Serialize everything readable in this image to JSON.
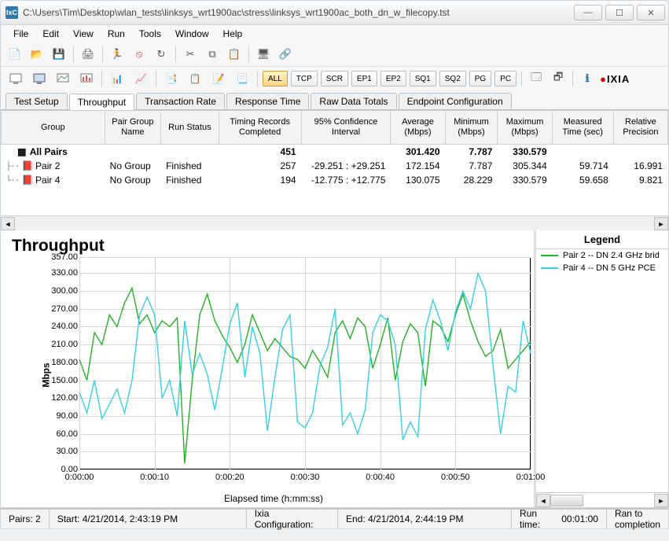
{
  "window": {
    "icon_text": "IxC",
    "title": "C:\\Users\\Tim\\Desktop\\wlan_tests\\linksys_wrt1900ac\\stress\\linksys_wrt1900ac_both_dn_w_filecopy.tst"
  },
  "menu": [
    "File",
    "Edit",
    "View",
    "Run",
    "Tools",
    "Window",
    "Help"
  ],
  "toolbar2": {
    "filters": [
      "ALL",
      "TCP",
      "SCR",
      "EP1",
      "EP2",
      "SQ1",
      "SQ2",
      "PG",
      "PC"
    ],
    "active_filter": "ALL",
    "brand": "IXIA"
  },
  "tabs": {
    "items": [
      "Test Setup",
      "Throughput",
      "Transaction Rate",
      "Response Time",
      "Raw Data Totals",
      "Endpoint Configuration"
    ],
    "active": "Throughput"
  },
  "grid": {
    "headers": [
      "Group",
      "Pair Group Name",
      "Run Status",
      "Timing Records Completed",
      "95% Confidence Interval",
      "Average (Mbps)",
      "Minimum (Mbps)",
      "Maximum (Mbps)",
      "Measured Time (sec)",
      "Relative Precision"
    ],
    "rows": [
      {
        "bold": true,
        "icon": "grid-icon",
        "group": "All Pairs",
        "pg": "",
        "status": "",
        "trc": "451",
        "ci": "",
        "avg": "301.420",
        "min": "7.787",
        "max": "330.579",
        "mt": "",
        "rp": ""
      },
      {
        "bold": false,
        "icon": "pair-icon",
        "prefix": "├··",
        "group": "Pair 2",
        "pg": "No Group",
        "status": "Finished",
        "trc": "257",
        "ci": "-29.251 : +29.251",
        "avg": "172.154",
        "min": "7.787",
        "max": "305.344",
        "mt": "59.714",
        "rp": "16.991"
      },
      {
        "bold": false,
        "icon": "pair-icon",
        "prefix": "└··",
        "group": "Pair 4",
        "pg": "No Group",
        "status": "Finished",
        "trc": "194",
        "ci": "-12.775 : +12.775",
        "avg": "130.075",
        "min": "28.229",
        "max": "330.579",
        "mt": "59.658",
        "rp": "9.821"
      }
    ]
  },
  "chart_data": {
    "type": "line",
    "title": "Throughput",
    "xlabel": "Elapsed time (h:mm:ss)",
    "ylabel": "Mbps",
    "ylim": [
      0,
      357
    ],
    "yticks": [
      0,
      30,
      60,
      90,
      120,
      150,
      180,
      210,
      240,
      270,
      300,
      330,
      357
    ],
    "xticks": [
      "0:00:00",
      "0:00:10",
      "0:00:20",
      "0:00:30",
      "0:00:40",
      "0:00:50",
      "0:01:00"
    ],
    "x": [
      0,
      1,
      2,
      3,
      4,
      5,
      6,
      7,
      8,
      9,
      10,
      11,
      12,
      13,
      14,
      15,
      16,
      17,
      18,
      19,
      20,
      21,
      22,
      23,
      24,
      25,
      26,
      27,
      28,
      29,
      30,
      31,
      32,
      33,
      34,
      35,
      36,
      37,
      38,
      39,
      40,
      41,
      42,
      43,
      44,
      45,
      46,
      47,
      48,
      49,
      50,
      51,
      52,
      53,
      54,
      55,
      56,
      57,
      58,
      59,
      60
    ],
    "series": [
      {
        "name": "Pair 2 -- DN 2.4 GHz brid",
        "color": "#23b223",
        "values": [
          185,
          150,
          230,
          210,
          260,
          240,
          280,
          305,
          245,
          260,
          230,
          250,
          240,
          255,
          10,
          150,
          260,
          295,
          250,
          225,
          205,
          180,
          210,
          260,
          230,
          200,
          220,
          205,
          190,
          185,
          170,
          200,
          180,
          155,
          230,
          250,
          220,
          255,
          240,
          170,
          210,
          255,
          150,
          215,
          245,
          230,
          140,
          250,
          240,
          215,
          260,
          295,
          250,
          215,
          190,
          200,
          235,
          170,
          185,
          200,
          215
        ]
      },
      {
        "name": "Pair 4 -- DN 5 GHz PCE",
        "color": "#35d0e6",
        "values": [
          130,
          95,
          150,
          85,
          110,
          135,
          95,
          150,
          260,
          290,
          260,
          120,
          150,
          90,
          250,
          160,
          195,
          160,
          100,
          170,
          245,
          280,
          155,
          240,
          195,
          65,
          155,
          235,
          260,
          80,
          70,
          95,
          175,
          205,
          270,
          75,
          95,
          60,
          100,
          230,
          260,
          250,
          210,
          50,
          80,
          55,
          235,
          285,
          250,
          200,
          265,
          300,
          270,
          330,
          300,
          175,
          60,
          140,
          130,
          250,
          195
        ]
      }
    ]
  },
  "legend": {
    "title": "Legend"
  },
  "status": {
    "pairs_label": "Pairs:",
    "pairs": "2",
    "start_label": "Start:",
    "start": "4/21/2014, 2:43:19 PM",
    "config_label": "Ixia Configuration:",
    "end_label": "End:",
    "end": "4/21/2014, 2:44:19 PM",
    "runtime_label": "Run time:",
    "runtime": "00:01:00",
    "completion": "Ran to completion"
  }
}
